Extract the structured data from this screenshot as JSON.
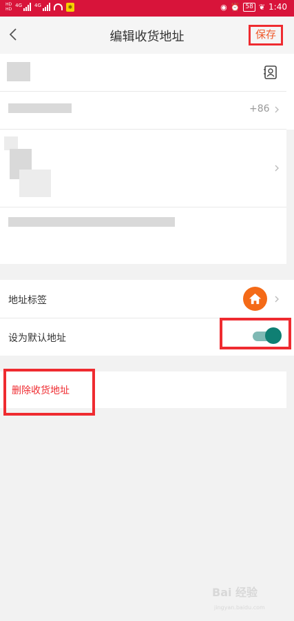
{
  "status_bar": {
    "time": "1:40",
    "battery": "58",
    "signal_tag_1": "4G",
    "signal_tag_2": "4G",
    "hd_label": "HD"
  },
  "header": {
    "title": "编辑收货地址",
    "save_label": "保存"
  },
  "form": {
    "phone_country_code": "+86"
  },
  "settings": {
    "address_tag_label": "地址标签",
    "default_address_label": "设为默认地址",
    "default_address_enabled": true
  },
  "actions": {
    "delete_label": "删除收货地址"
  },
  "watermark": {
    "brand": "Bai 经验",
    "url": "jingyan.baidu.com"
  },
  "colors": {
    "status_bar": "#d8143a",
    "accent_red": "#ef2b30",
    "save_text": "#ef5a2c",
    "toggle_on": "#0f7f73",
    "tag_badge": "#f46a17"
  }
}
